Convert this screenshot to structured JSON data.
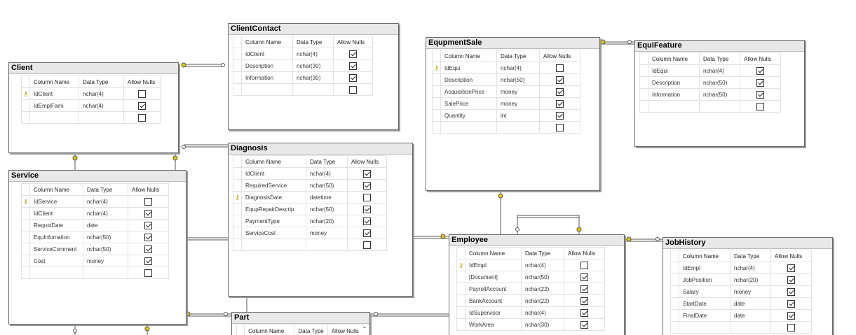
{
  "headers": {
    "column_name": "Column Name",
    "data_type": "Data Type",
    "allow_nulls": "Allow Nulls"
  },
  "icons": {
    "key": "key-icon",
    "scroll": "chevron-up-icon"
  },
  "tables": [
    {
      "id": "Client",
      "title": "Client",
      "rows": [
        {
          "name": "IdClient",
          "type": "nchar(4)",
          "nulls": false,
          "pk": true
        },
        {
          "name": "IdEmplFami",
          "type": "nchar(4)",
          "nulls": true,
          "pk": false
        },
        {
          "name": "",
          "type": "",
          "nulls": false,
          "pk": false
        }
      ]
    },
    {
      "id": "ClientContact",
      "title": "ClientContact",
      "rows": [
        {
          "name": "IdClient",
          "type": "nchar(4)",
          "nulls": true,
          "pk": false
        },
        {
          "name": "Description",
          "type": "nchar(30)",
          "nulls": true,
          "pk": false
        },
        {
          "name": "Information",
          "type": "nchar(30)",
          "nulls": true,
          "pk": false
        },
        {
          "name": "",
          "type": "",
          "nulls": false,
          "pk": false
        }
      ]
    },
    {
      "id": "Diagnosis",
      "title": "Diagnosis",
      "rows": [
        {
          "name": "IdClient",
          "type": "nchar(4)",
          "nulls": true,
          "pk": false
        },
        {
          "name": "RequiredService",
          "type": "nchar(50)",
          "nulls": true,
          "pk": false
        },
        {
          "name": "DiagnosisDate",
          "type": "datetime",
          "nulls": false,
          "pk": true
        },
        {
          "name": "EqupRepairDescrip",
          "type": "nchar(50)",
          "nulls": true,
          "pk": false
        },
        {
          "name": "PaymentType",
          "type": "nchar(20)",
          "nulls": true,
          "pk": false
        },
        {
          "name": "ServiceCost",
          "type": "money",
          "nulls": true,
          "pk": false
        },
        {
          "name": "",
          "type": "",
          "nulls": false,
          "pk": false
        }
      ]
    },
    {
      "id": "Service",
      "title": "Service",
      "rows": [
        {
          "name": "IdService",
          "type": "nchar(4)",
          "nulls": false,
          "pk": true
        },
        {
          "name": "IdClient",
          "type": "nchar(4)",
          "nulls": true,
          "pk": false
        },
        {
          "name": "RequstDate",
          "type": "date",
          "nulls": true,
          "pk": false
        },
        {
          "name": "EquInfomation",
          "type": "nchar(50)",
          "nulls": true,
          "pk": false
        },
        {
          "name": "ServiceComment",
          "type": "nchar(50)",
          "nulls": true,
          "pk": false
        },
        {
          "name": "Cost",
          "type": "money",
          "nulls": true,
          "pk": false
        },
        {
          "name": "",
          "type": "",
          "nulls": false,
          "pk": false
        }
      ]
    },
    {
      "id": "EquipmentSale",
      "title": "EqupmentSale",
      "rows": [
        {
          "name": "IdEqui",
          "type": "nchar(4)",
          "nulls": false,
          "pk": true
        },
        {
          "name": "Description",
          "type": "nchar(50)",
          "nulls": true,
          "pk": false
        },
        {
          "name": "AcquisitionPrice",
          "type": "money",
          "nulls": true,
          "pk": false
        },
        {
          "name": "SalePrice",
          "type": "money",
          "nulls": true,
          "pk": false
        },
        {
          "name": "Quantity",
          "type": "int",
          "nulls": true,
          "pk": false
        },
        {
          "name": "",
          "type": "",
          "nulls": false,
          "pk": false
        }
      ]
    },
    {
      "id": "EquiFeature",
      "title": "EquiFeature",
      "rows": [
        {
          "name": "IdEqui",
          "type": "nchar(4)",
          "nulls": true,
          "pk": false
        },
        {
          "name": "Description",
          "type": "nchar(50)",
          "nulls": true,
          "pk": false
        },
        {
          "name": "Information",
          "type": "nchar(50)",
          "nulls": true,
          "pk": false
        },
        {
          "name": "",
          "type": "",
          "nulls": false,
          "pk": false
        }
      ]
    },
    {
      "id": "Employee",
      "title": "Employee",
      "rows": [
        {
          "name": "IdEmpl",
          "type": "nchar(4)",
          "nulls": false,
          "pk": true
        },
        {
          "name": "[Document]",
          "type": "nchar(50)",
          "nulls": true,
          "pk": false
        },
        {
          "name": "PayrollAccount",
          "type": "nchar(22)",
          "nulls": true,
          "pk": false
        },
        {
          "name": "BankAccount",
          "type": "nchar(22)",
          "nulls": true,
          "pk": false
        },
        {
          "name": "IdSupervisor",
          "type": "nchar(4)",
          "nulls": true,
          "pk": false
        },
        {
          "name": "WorkArea",
          "type": "nchar(30)",
          "nulls": true,
          "pk": false
        }
      ]
    },
    {
      "id": "JobHistory",
      "title": "JobHistory",
      "rows": [
        {
          "name": "IdEmpl",
          "type": "nchar(4)",
          "nulls": true,
          "pk": false
        },
        {
          "name": "JobPosition",
          "type": "nchar(20)",
          "nulls": true,
          "pk": false
        },
        {
          "name": "Salary",
          "type": "money",
          "nulls": true,
          "pk": false
        },
        {
          "name": "StartDate",
          "type": "date",
          "nulls": true,
          "pk": false
        },
        {
          "name": "FinalDate",
          "type": "date",
          "nulls": true,
          "pk": false
        },
        {
          "name": "",
          "type": "",
          "nulls": false,
          "pk": false
        }
      ]
    },
    {
      "id": "Part",
      "title": "Part",
      "rows": []
    }
  ]
}
